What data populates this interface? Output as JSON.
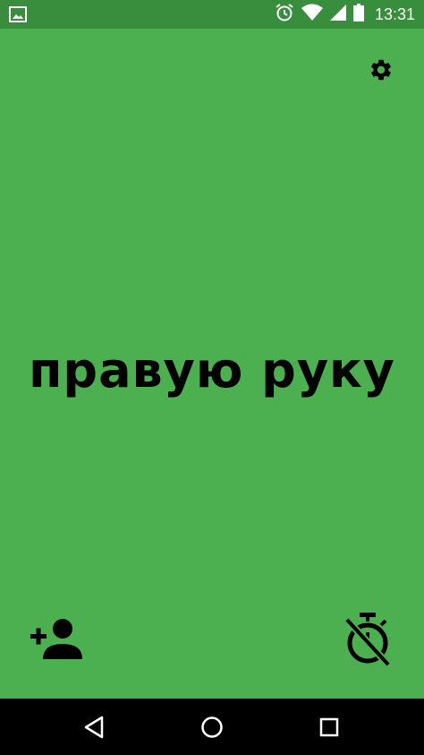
{
  "status_bar": {
    "time": "13:31",
    "icons": [
      "image-notification-icon",
      "alarm-icon",
      "wifi-icon",
      "signal-icon",
      "battery-icon"
    ]
  },
  "game": {
    "phrase": "правую руку",
    "background_color": "#4CAF50",
    "icons": [
      "settings-gear-icon",
      "add-person-icon",
      "timer-off-icon"
    ]
  },
  "nav_bar": {
    "icons": [
      "back-icon",
      "home-icon",
      "recents-icon"
    ]
  }
}
